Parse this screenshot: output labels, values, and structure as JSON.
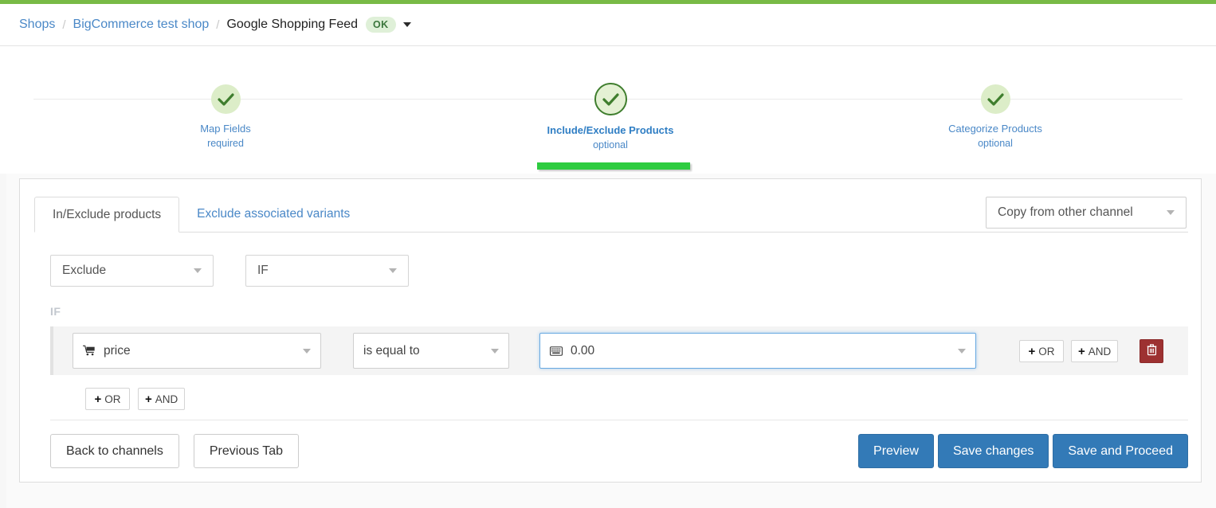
{
  "theme": {
    "accent_green": "#78ba46",
    "progress_green": "#2ecc40",
    "link_blue": "#4a88c7",
    "primary_blue": "#337ab7",
    "danger_red": "#9d3131",
    "badge_bg": "#dff0d8",
    "badge_text": "#3c763d"
  },
  "breadcrumb": {
    "items": [
      {
        "label": "Shops",
        "type": "link"
      },
      {
        "label": "BigCommerce test shop",
        "type": "link"
      },
      {
        "label": "Google Shopping Feed",
        "type": "current"
      }
    ],
    "separator": "/",
    "status_badge": "OK",
    "status_caret_icon": "caret-down-icon"
  },
  "wizard": {
    "steps": [
      {
        "label": "Map Fields",
        "sub": "required",
        "state": "complete",
        "icon": "check-icon"
      },
      {
        "label": "Include/Exclude Products",
        "sub": "optional",
        "state": "active",
        "icon": "check-icon"
      },
      {
        "label": "Categorize Products",
        "sub": "optional",
        "state": "complete",
        "icon": "check-icon"
      }
    ]
  },
  "card": {
    "tabs": [
      {
        "label": "In/Exclude products",
        "selected": true
      },
      {
        "label": "Exclude associated variants",
        "selected": false
      }
    ],
    "copy_channel": {
      "value": "Copy from other channel",
      "caret_icon": "chevron-down-icon"
    },
    "mode": {
      "action_value": "Exclude",
      "conjunction_value": "IF"
    },
    "if_caption": "IF",
    "condition": {
      "field": {
        "value": "price",
        "icon": "shopping-cart-icon"
      },
      "operator": {
        "value": "is equal to"
      },
      "value_field": {
        "value": "0.00",
        "icon": "keyboard-icon",
        "focused": true
      },
      "row_buttons": [
        {
          "label": "OR",
          "icon": "plus-icon"
        },
        {
          "label": "AND",
          "icon": "plus-icon"
        }
      ],
      "delete_icon": "trash-icon"
    },
    "group_buttons": [
      {
        "label": "OR",
        "icon": "plus-icon"
      },
      {
        "label": "AND",
        "icon": "plus-icon"
      }
    ],
    "footer": {
      "secondary": [
        "Back to channels",
        "Previous Tab"
      ],
      "primary": [
        "Preview",
        "Save changes",
        "Save and Proceed"
      ]
    }
  }
}
